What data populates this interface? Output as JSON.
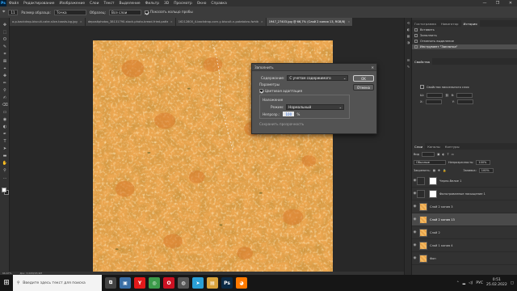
{
  "menu": {
    "app_logo": "Ps",
    "items": [
      "Файл",
      "Редактирование",
      "Изображение",
      "Слои",
      "Текст",
      "Выделение",
      "Фильтр",
      "3D",
      "Просмотр",
      "Окно",
      "Справка"
    ],
    "window_controls": [
      "—",
      "❐",
      "✕"
    ]
  },
  "options_bar": {
    "tool_size": "11",
    "tolerance_label": "Размер образца:",
    "tolerance_value": "Точка",
    "sample_label": "Образец:",
    "sample_value": "Все слои",
    "show_ring_label": "Показать кольцо пробы"
  },
  "doc_tabs": [
    {
      "label": "a-p-backdrop-biscuit-cake-slice-toasts-bg.jpg",
      "active": false
    },
    {
      "label": "depositphotos_38131790-stock-photo-bread-fried-pattern-texture-bg.jpg",
      "active": false
    },
    {
      "label": "16212800_4-backdrop-corn-y-biscuit-n-potatobro-fwhite.jpg",
      "active": false
    },
    {
      "label": "1947_27403.jpg @ 66,7% (Слой 2 копия 13, RGB/8)",
      "active": true
    }
  ],
  "tools": {
    "icons": [
      "move-icon",
      "marquee-icon",
      "lasso-icon",
      "quick-select-icon",
      "crop-icon",
      "frame-icon",
      "eyedropper-icon",
      "healing-icon",
      "brush-icon",
      "stamp-icon",
      "history-brush-icon",
      "eraser-icon",
      "gradient-icon",
      "blur-icon",
      "dodge-icon",
      "pen-icon",
      "type-icon",
      "path-select-icon",
      "shape-icon",
      "hand-icon",
      "zoom-icon",
      "more-icon"
    ],
    "glyphs": [
      "✥",
      "⬚",
      "ʘ",
      "✎",
      "⌗",
      "⊠",
      "⌖",
      "✚",
      "✏",
      "⚲",
      "✍",
      "⌫",
      "▭",
      "◉",
      "◐",
      "✒",
      "T",
      "➤",
      "▬",
      "✋",
      "⚲",
      "…"
    ],
    "foreground_color": "#ffffff",
    "background_color": "#1a1a1a"
  },
  "status": {
    "zoom": "66,67%",
    "doc_info": "Док: 3,00M/93,9M"
  },
  "dialog": {
    "title": "Заполнить",
    "content_label": "Содержание:",
    "content_value": "С учетом содержимого",
    "options_label": "Параметры",
    "color_adapt_label": "Цветовая адаптация",
    "blending_label": "Наложение",
    "mode_label": "Режим:",
    "mode_value": "Нормальный",
    "opacity_label": "Непрозр.:",
    "opacity_value": "100",
    "opacity_unit": "%",
    "preserve_label": "Сохранить прозрачность",
    "ok_label": "OK",
    "cancel_label": "Отмена",
    "close_glyph": "✕"
  },
  "history_panel": {
    "tabs": [
      "Гистограмма",
      "Навигатор",
      "История"
    ],
    "items": [
      {
        "label": "Вставить",
        "selected": false
      },
      {
        "label": "Заполнить",
        "selected": false
      },
      {
        "label": "Отменить выделение",
        "selected": false
      },
      {
        "label": "Инструмент \"Заплатка\"",
        "selected": true
      }
    ]
  },
  "properties_panel": {
    "tabs": [
      "Свойства"
    ],
    "title": "Свойства пиксельного слоя",
    "w_label": "Ш:",
    "h_label": "В:",
    "x_label": "X:",
    "y_label": "Y:"
  },
  "layers_panel": {
    "tabs": [
      "Слои",
      "Каналы",
      "Контуры"
    ],
    "kind_label": "Вид",
    "blend_mode": "Обычные",
    "opacity_label": "Непрозрачность:",
    "opacity_value": "100%",
    "lock_label": "Закрепить:",
    "fill_label": "Заливка:",
    "fill_value": "100%",
    "layers": [
      {
        "name": "Черно-белое 1",
        "thumb": "mask",
        "selected": false,
        "visible": true
      },
      {
        "name": "Фильтрованные насыщение 1",
        "thumb": "mask",
        "selected": false,
        "visible": true
      },
      {
        "name": "Слой 2 копия 3",
        "thumb": "tex",
        "selected": false,
        "visible": true
      },
      {
        "name": "Слой 2 копия 13",
        "thumb": "tex",
        "selected": true,
        "visible": true
      },
      {
        "name": "Слой 2",
        "thumb": "tex",
        "selected": false,
        "visible": true
      },
      {
        "name": "Слой 1 копия 4",
        "thumb": "tex",
        "selected": false,
        "visible": true
      },
      {
        "name": "Фон",
        "thumb": "tex",
        "selected": false,
        "visible": true
      }
    ]
  },
  "taskbar": {
    "search_placeholder": "Введите здесь текст для поиска",
    "apps": [
      {
        "name": "task-view-icon",
        "glyph": "⧉",
        "color": "#444444"
      },
      {
        "name": "files-icon",
        "glyph": "▣",
        "color": "#3a6ea5"
      },
      {
        "name": "yandex-icon",
        "glyph": "Y",
        "color": "#e21a1a"
      },
      {
        "name": "chrome-icon",
        "glyph": "◎",
        "color": "#3c9a4a"
      },
      {
        "name": "opera-icon",
        "glyph": "O",
        "color": "#cc1122"
      },
      {
        "name": "media-icon",
        "glyph": "◍",
        "color": "#555555"
      },
      {
        "name": "telegram-icon",
        "glyph": "➤",
        "color": "#2a9fd6"
      },
      {
        "name": "folder-icon",
        "glyph": "▤",
        "color": "#d9a23b"
      },
      {
        "name": "photoshop-icon",
        "glyph": "Ps",
        "color": "#0b2a45"
      },
      {
        "name": "browser-icon",
        "glyph": "◕",
        "color": "#ff7a00"
      }
    ],
    "language": "РУС",
    "time": "0:51",
    "date": "25.02.2022"
  }
}
